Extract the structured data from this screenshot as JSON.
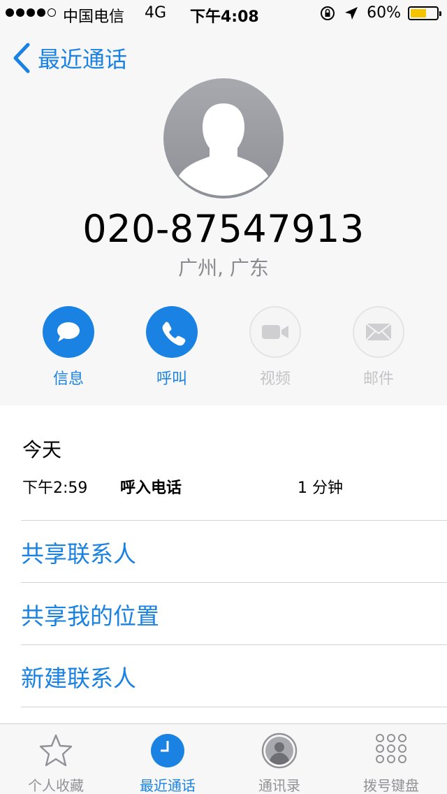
{
  "status_bar": {
    "carrier": "中国电信",
    "network": "4G",
    "time": "下午4:08",
    "battery_percent": "60%",
    "battery_level": 0.6,
    "battery_color": "#f5c400"
  },
  "nav": {
    "back_label": "最近通话"
  },
  "contact": {
    "phone_number": "020-87547913",
    "location": "广州, 广东"
  },
  "actions": [
    {
      "label": "信息",
      "icon": "message-icon",
      "enabled": true
    },
    {
      "label": "呼叫",
      "icon": "phone-icon",
      "enabled": true
    },
    {
      "label": "视频",
      "icon": "video-icon",
      "enabled": false
    },
    {
      "label": "邮件",
      "icon": "mail-icon",
      "enabled": false
    }
  ],
  "history": {
    "title": "今天",
    "calls": [
      {
        "time": "下午2:59",
        "type": "呼入电话",
        "duration": "1 分钟"
      }
    ]
  },
  "menu": {
    "share_contact": "共享联系人",
    "share_location": "共享我的位置",
    "new_contact": "新建联系人"
  },
  "tabs": [
    {
      "label": "个人收藏",
      "icon": "star-icon",
      "active": false
    },
    {
      "label": "最近通话",
      "icon": "clock-icon",
      "active": true
    },
    {
      "label": "通讯录",
      "icon": "contacts-icon",
      "active": false
    },
    {
      "label": "拨号键盘",
      "icon": "keypad-icon",
      "active": false
    }
  ],
  "colors": {
    "accent": "#1a82e2",
    "disabled_text": "#c4c4c6",
    "inactive_tab": "#929296"
  }
}
